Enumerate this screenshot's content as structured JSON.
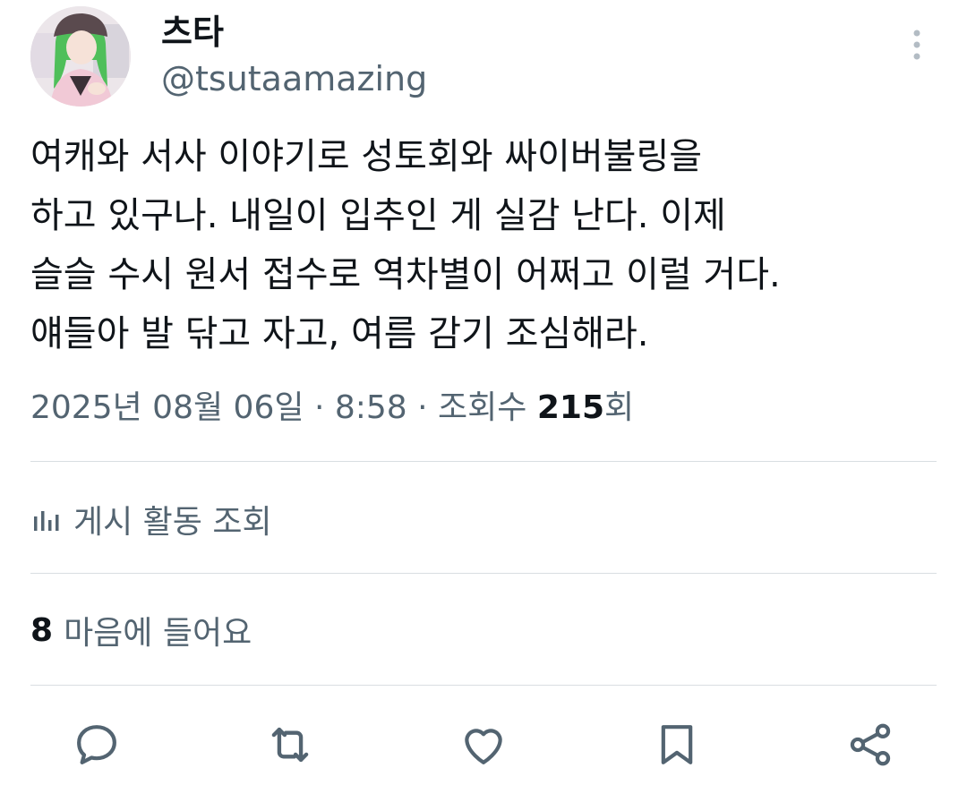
{
  "author": {
    "display_name": "츠타",
    "handle": "@tsutaamazing",
    "avatar_icon": "avatar-illustration"
  },
  "tweet": {
    "lines": [
      "여캐와 서사 이야기로 성토회와 싸이버불링을",
      "하고 있구나. 내일이 입추인 게 실감 난다. 이제",
      "슬슬 수시 원서 접수로 역차별이 어쩌고 이럴 거다.",
      "얘들아 발 닦고 자고, 여름 감기 조심해라."
    ]
  },
  "meta": {
    "date": "2025년 08월 06일",
    "separator": "·",
    "time": "8:58",
    "views_label": "조회수",
    "views_count": "215",
    "views_suffix": "회"
  },
  "analytics": {
    "label": "게시 활동 조회",
    "icon": "bar-chart-icon"
  },
  "likes": {
    "count": "8",
    "label": "마음에 들어요"
  },
  "actions": [
    {
      "name": "reply",
      "icon": "reply-icon"
    },
    {
      "name": "retweet",
      "icon": "retweet-icon"
    },
    {
      "name": "like",
      "icon": "heart-icon"
    },
    {
      "name": "bookmark",
      "icon": "bookmark-icon"
    },
    {
      "name": "share",
      "icon": "share-icon"
    }
  ],
  "colors": {
    "text_primary": "#0f1419",
    "text_secondary": "#536471",
    "divider": "#d9dee2",
    "icon": "#536471"
  }
}
